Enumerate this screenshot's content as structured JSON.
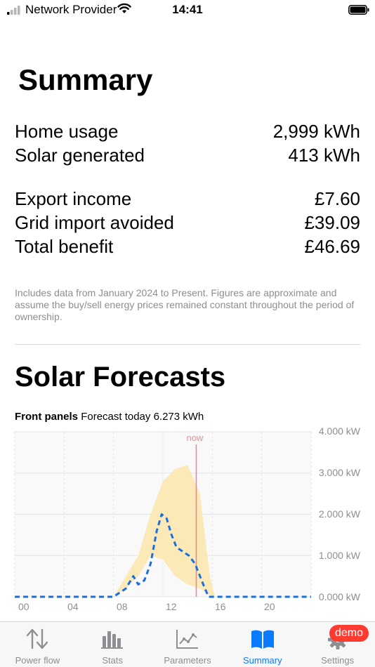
{
  "status": {
    "carrier": "Network Provider",
    "time": "14:41"
  },
  "summary": {
    "title": "Summary",
    "energy_rows": [
      {
        "label": "Home usage",
        "value": "2,999 kWh"
      },
      {
        "label": "Solar generated",
        "value": "413 kWh"
      }
    ],
    "money_rows": [
      {
        "label": "Export income",
        "value": "£7.60"
      },
      {
        "label": "Grid import avoided",
        "value": "£39.09"
      },
      {
        "label": "Total benefit",
        "value": "£46.69"
      }
    ],
    "note": "Includes data from January 2024 to Present. Figures are approximate and assume the buy/sell energy prices remained constant throughout the period of ownership."
  },
  "forecasts": {
    "title": "Solar Forecasts",
    "panel_name": "Front panels",
    "panel_text": "Forecast today 6.273 kWh"
  },
  "chart_data": {
    "type": "area",
    "y_tick_labels": [
      "4.000 kW",
      "3.000 kW",
      "2.000 kW",
      "1.000 kW",
      "0.000 kW"
    ],
    "x_tick_labels": [
      "00",
      "04",
      "08",
      "12",
      "16",
      "20"
    ],
    "ylim": [
      0,
      4
    ],
    "xlim": [
      0,
      24
    ],
    "now_label": "now",
    "now_hour": 14.7,
    "band_upper": [
      [
        0,
        0
      ],
      [
        8,
        0
      ],
      [
        9,
        0.5
      ],
      [
        10,
        1.0
      ],
      [
        11,
        2.0
      ],
      [
        12,
        2.8
      ],
      [
        13,
        3.1
      ],
      [
        14,
        3.2
      ],
      [
        15,
        2.5
      ],
      [
        15.8,
        0.5
      ],
      [
        16.2,
        0
      ],
      [
        24,
        0
      ]
    ],
    "band_lower": [
      [
        0,
        0
      ],
      [
        8,
        0
      ],
      [
        9,
        0.2
      ],
      [
        10,
        0.5
      ],
      [
        11,
        1.0
      ],
      [
        12,
        0.9
      ],
      [
        13,
        0.5
      ],
      [
        14,
        0.3
      ],
      [
        15,
        0.2
      ],
      [
        16,
        0
      ],
      [
        24,
        0
      ]
    ],
    "forecast": [
      [
        0,
        0
      ],
      [
        8,
        0
      ],
      [
        9,
        0.2
      ],
      [
        9.6,
        0.5
      ],
      [
        10,
        0.3
      ],
      [
        10.5,
        0.4
      ],
      [
        11,
        0.8
      ],
      [
        11.5,
        1.6
      ],
      [
        11.9,
        2.0
      ],
      [
        12.3,
        1.9
      ],
      [
        12.7,
        1.5
      ],
      [
        13.1,
        1.2
      ],
      [
        13.6,
        1.1
      ],
      [
        14.1,
        1.0
      ],
      [
        14.6,
        0.8
      ],
      [
        15,
        0.5
      ],
      [
        15.4,
        0.2
      ],
      [
        15.7,
        0
      ],
      [
        24,
        0
      ]
    ],
    "colors": {
      "band": "#fbe9b7",
      "forecast": "#1a6fe0",
      "now": "#f08090",
      "grid": "#e3e3e3"
    }
  },
  "tabs": [
    {
      "label": "Power flow",
      "icon": "arrows-up-down-icon"
    },
    {
      "label": "Stats",
      "icon": "bar-chart-icon"
    },
    {
      "label": "Parameters",
      "icon": "line-chart-icon"
    },
    {
      "label": "Summary",
      "icon": "book-icon",
      "active": true
    },
    {
      "label": "Settings",
      "icon": "gear-icon"
    }
  ],
  "badge": "demo"
}
